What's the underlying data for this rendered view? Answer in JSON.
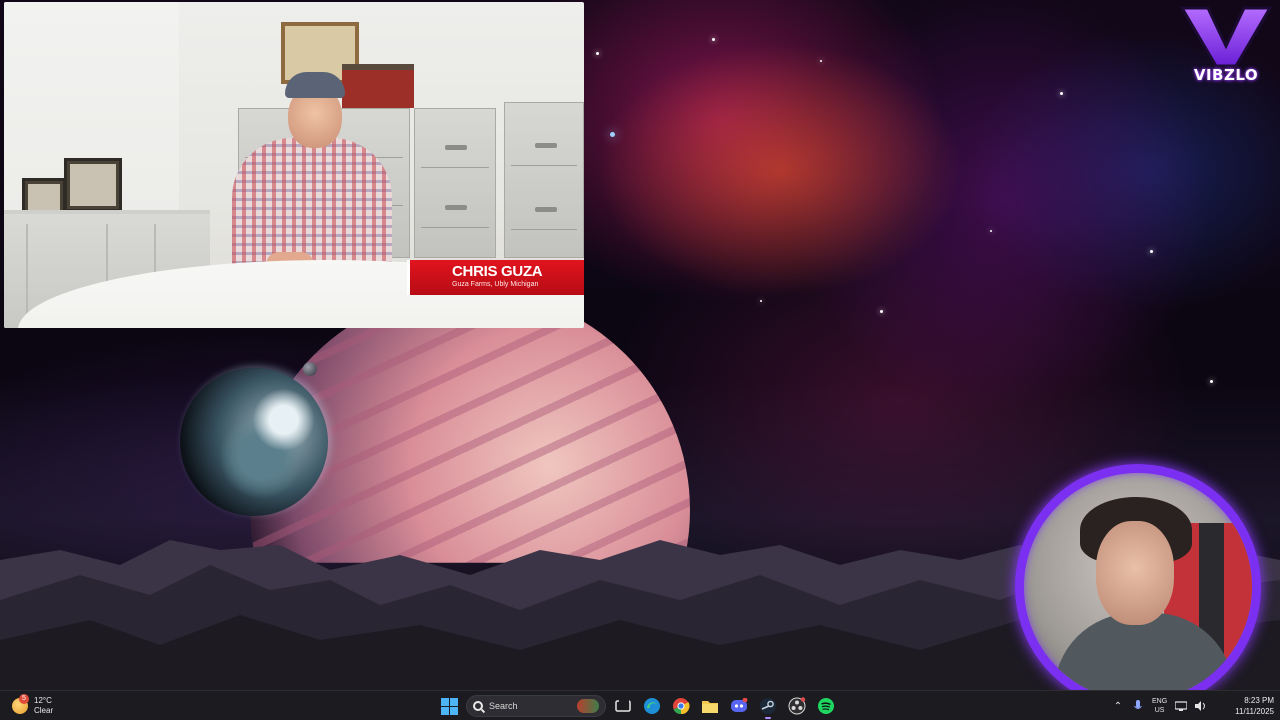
{
  "video": {
    "lower_third_name": "CHRIS GUZA",
    "lower_third_subtitle": "Guza Farms, Ubly Michigan"
  },
  "logo": {
    "text": "VIBZLO",
    "color": "#8a3cff"
  },
  "taskbar": {
    "weather": {
      "temperature": "12°C",
      "condition": "Clear",
      "badge": "5",
      "icon": "weather-moon-icon"
    },
    "search": {
      "placeholder": "Search"
    },
    "pinned_apps": [
      {
        "name": "start",
        "icon": "windows-start-icon"
      },
      {
        "name": "task-view",
        "icon": "task-view-icon"
      },
      {
        "name": "edge",
        "icon": "edge-icon"
      },
      {
        "name": "chrome",
        "icon": "chrome-icon"
      },
      {
        "name": "file-explorer",
        "icon": "folder-icon"
      },
      {
        "name": "discord",
        "icon": "discord-icon"
      },
      {
        "name": "steam",
        "icon": "steam-icon"
      },
      {
        "name": "obs",
        "icon": "obs-icon"
      },
      {
        "name": "spotify",
        "icon": "spotify-icon"
      }
    ],
    "tray": {
      "language_top": "ENG",
      "language_bottom": "US"
    },
    "clock": {
      "time": "8:23 PM",
      "date": "11/11/2025"
    }
  },
  "colors": {
    "accent_purple": "#7b2ff0",
    "lower_third_red": "#d8111b",
    "taskbar_bg": "#1c1c20"
  }
}
